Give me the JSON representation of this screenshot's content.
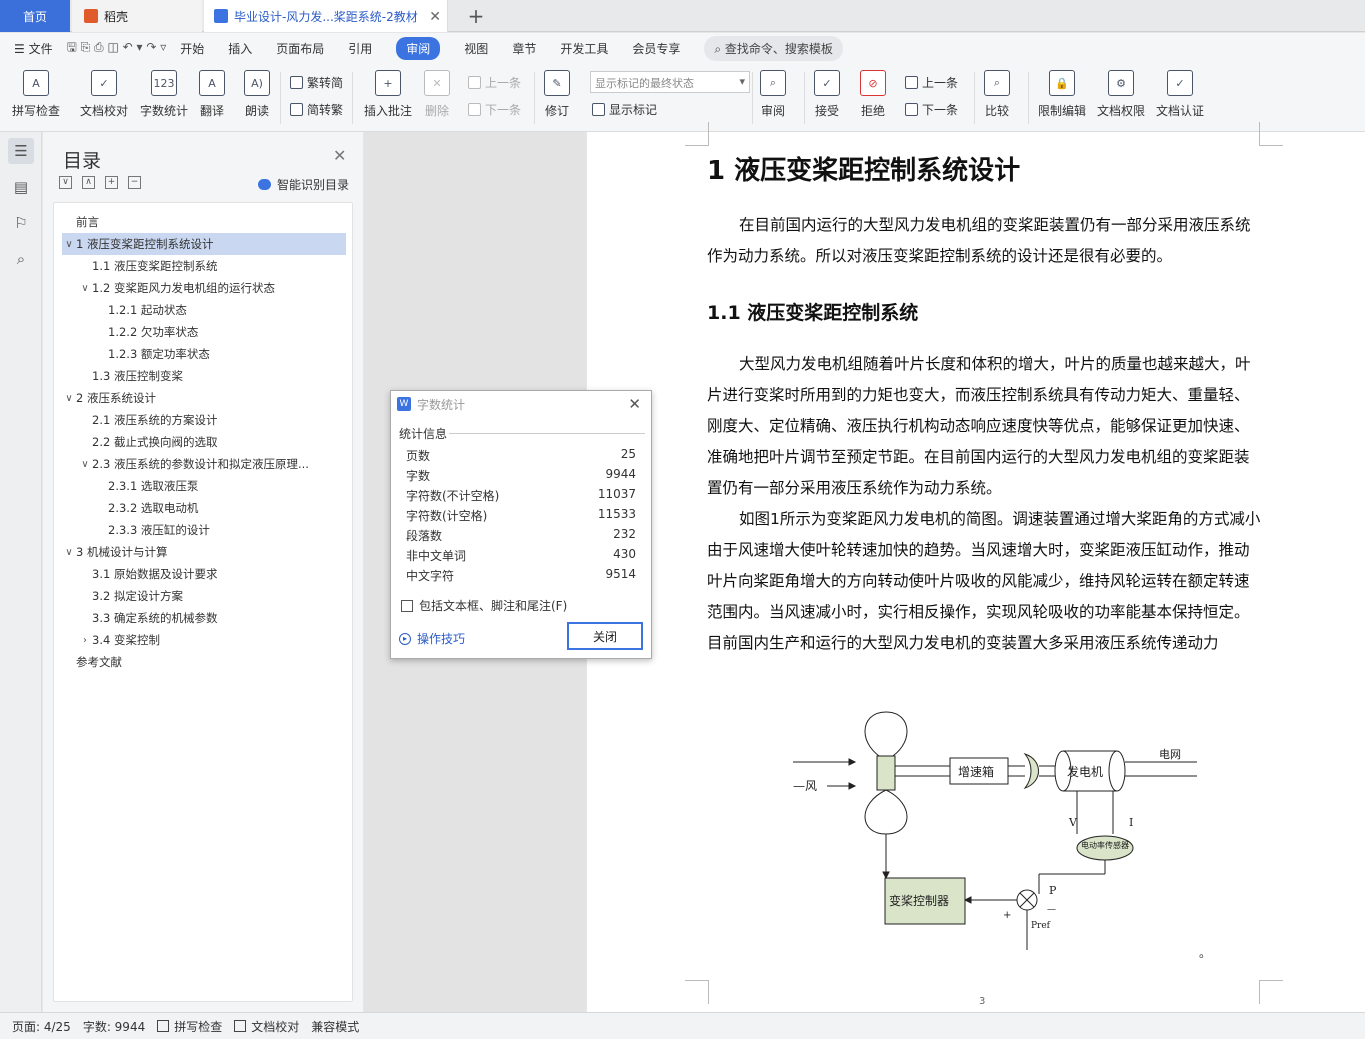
{
  "tabs": {
    "home": "首页",
    "daoke": "稻壳",
    "doc": "毕业设计-风力发...桨距系统-2教材",
    "plus": "+"
  },
  "menu": {
    "file": "文件",
    "items": [
      "开始",
      "插入",
      "页面布局",
      "引用",
      "审阅",
      "视图",
      "章节",
      "开发工具",
      "会员专享"
    ],
    "search": "查找命令、搜索模板"
  },
  "ribbon": {
    "spell": "拼写检查",
    "proof": "文档校对",
    "count": "字数统计",
    "translate": "翻译",
    "read": "朗读",
    "trad": "繁转简",
    "simp": "简转繁",
    "insert_comment": "插入批注",
    "delete": "删除",
    "prev": "上一条",
    "next": "下一条",
    "revise": "修订",
    "mark_state": "显示标记的最终状态",
    "show_marks": "显示标记",
    "review": "审阅",
    "accept": "接受",
    "reject": "拒绝",
    "prev2": "上一条",
    "next2": "下一条",
    "compare": "比较",
    "restrict": "限制编辑",
    "permission": "文档权限",
    "certify": "文档认证"
  },
  "toc": {
    "title": "目录",
    "smart": "智能识别目录",
    "items": [
      {
        "label": "前言",
        "arrow": ""
      },
      {
        "label": "1 液压变桨距控制系统设计",
        "arrow": "∨"
      },
      {
        "label": "1.1 液压变桨距控制系统",
        "arrow": ""
      },
      {
        "label": "1.2 变桨距风力发电机组的运行状态",
        "arrow": "∨"
      },
      {
        "label": "1.2.1 起动状态",
        "arrow": ""
      },
      {
        "label": "1.2.2 欠功率状态",
        "arrow": ""
      },
      {
        "label": "1.2.3 额定功率状态",
        "arrow": ""
      },
      {
        "label": "1.3 液压控制变桨",
        "arrow": ""
      },
      {
        "label": "2 液压系统设计",
        "arrow": "∨"
      },
      {
        "label": "2.1 液压系统的方案设计",
        "arrow": ""
      },
      {
        "label": "2.2 截止式换向阀的选取",
        "arrow": ""
      },
      {
        "label": "2.3 液压系统的参数设计和拟定液压原理...",
        "arrow": "∨"
      },
      {
        "label": "2.3.1 选取液压泵",
        "arrow": ""
      },
      {
        "label": "2.3.2 选取电动机",
        "arrow": ""
      },
      {
        "label": "2.3.3 液压缸的设计",
        "arrow": ""
      },
      {
        "label": "3 机械设计与计算",
        "arrow": "∨"
      },
      {
        "label": "3.1 原始数据及设计要求",
        "arrow": ""
      },
      {
        "label": "3.2 拟定设计方案",
        "arrow": ""
      },
      {
        "label": "3.3 确定系统的机械参数",
        "arrow": ""
      },
      {
        "label": "3.4 变桨控制",
        "arrow": "›"
      },
      {
        "label": "参考文献",
        "arrow": ""
      }
    ]
  },
  "doc": {
    "h1": "1 液压变桨距控制系统设计",
    "p1": "在目前国内运行的大型风力发电机组的变桨距装置仍有一部分采用液压系统作为动力系统。所以对液压变桨距控制系统的设计还是很有必要的。",
    "h2": "1.1 液压变桨距控制系统",
    "p2": "大型风力发电机组随着叶片长度和体积的增大，叶片的质量也越来越大，叶片进行变桨时所用到的力矩也变大，而液压控制系统具有传动力矩大、重量轻、刚度大、定位精确、液压执行机构动态响应速度快等优点，能够保证更加快速、准确地把叶片调节至预定节距。在目前国内运行的大型风力发电机组的变桨距装置仍有一部分采用液压系统作为动力系统。",
    "p3": "如图1所示为变桨距风力发电机的简图。调速装置通过增大桨距角的方式减小由于风速增大使叶轮转速加快的趋势。当风速增大时，变桨距液压缸动作，推动叶片向桨距角增大的方向转动使叶片吸收的风能减少，维持风轮运转在额定转速范围内。当风速减小时，实行相反操作，实现风轮吸收的功率能基本保持恒定。目前国内生产和运行的大型风力发电机的变装置大多采用液压系统传递动力",
    "page_num": "3",
    "dot": "。"
  },
  "diagram": {
    "wind": "—风",
    "gearbox": "增速箱",
    "generator": "发电机",
    "grid": "电网",
    "v": "V",
    "i": "I",
    "sensor": "电动率传感器",
    "controller": "变桨控制器",
    "plus": "+",
    "p": "P",
    "minus": "—",
    "pref": "Pref"
  },
  "dialog": {
    "title": "字数统计",
    "section": "统计信息",
    "rows": [
      {
        "label": "页数",
        "value": "25"
      },
      {
        "label": "字数",
        "value": "9944"
      },
      {
        "label": "字符数(不计空格)",
        "value": "11037"
      },
      {
        "label": "字符数(计空格)",
        "value": "11533"
      },
      {
        "label": "段落数",
        "value": "232"
      },
      {
        "label": "非中文单词",
        "value": "430"
      },
      {
        "label": "中文字符",
        "value": "9514"
      }
    ],
    "include": "包括文本框、脚注和尾注(F)",
    "tips": "操作技巧",
    "close": "关闭"
  },
  "status": {
    "page": "页面: 4/25",
    "words": "字数: 9944",
    "spell": "拼写检查",
    "proof": "文档校对",
    "compat": "兼容模式"
  }
}
